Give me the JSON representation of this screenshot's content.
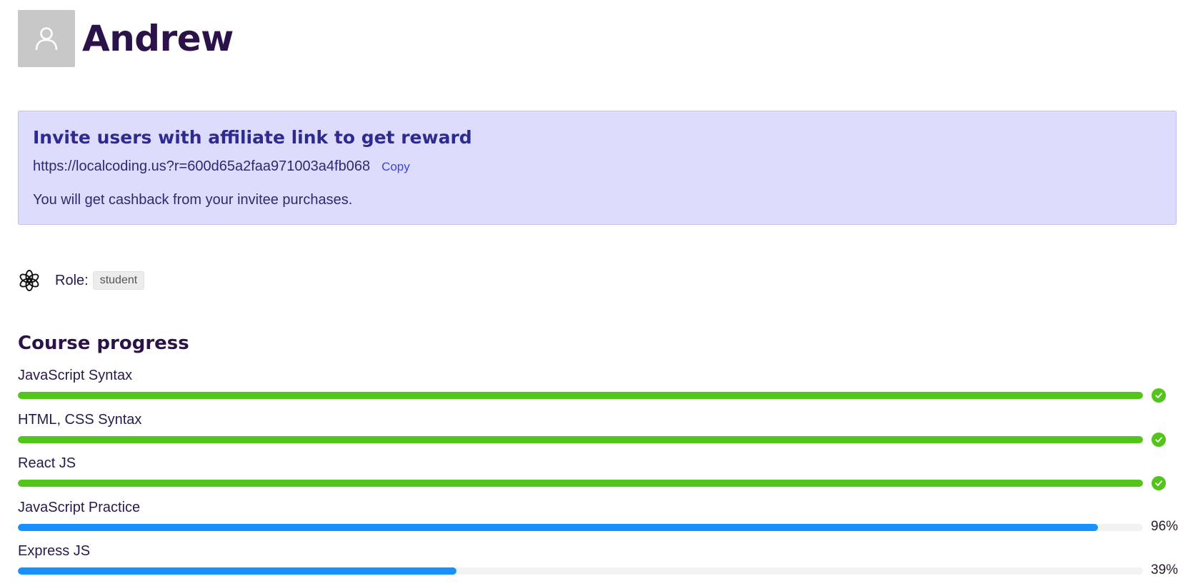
{
  "user": {
    "name": "Andrew"
  },
  "affiliate": {
    "title": "Invite users with affiliate link to get reward",
    "link": "https://localcoding.us?r=600d65a2faa971003a4fb068",
    "copy_label": "Copy",
    "description": "You will get cashback from your invitee purchases."
  },
  "role": {
    "label": "Role:",
    "value": "student"
  },
  "progress": {
    "title": "Course progress",
    "courses": [
      {
        "name": "JavaScript Syntax",
        "percent": 100,
        "complete": true
      },
      {
        "name": "HTML, CSS Syntax",
        "percent": 100,
        "complete": true
      },
      {
        "name": "React JS",
        "percent": 100,
        "complete": true
      },
      {
        "name": "JavaScript Practice",
        "percent": 96,
        "label": "96%",
        "complete": false
      },
      {
        "name": "Express JS",
        "percent": 39,
        "label": "39%",
        "complete": false
      }
    ]
  },
  "colors": {
    "complete": "#52c41a",
    "in_progress": "#1890ff",
    "track": "#f2f2f2",
    "box_bg": "#dedcfd"
  },
  "icons": {
    "avatar": "user-icon",
    "role": "openai-logo-icon",
    "status": "check-circle-icon"
  }
}
